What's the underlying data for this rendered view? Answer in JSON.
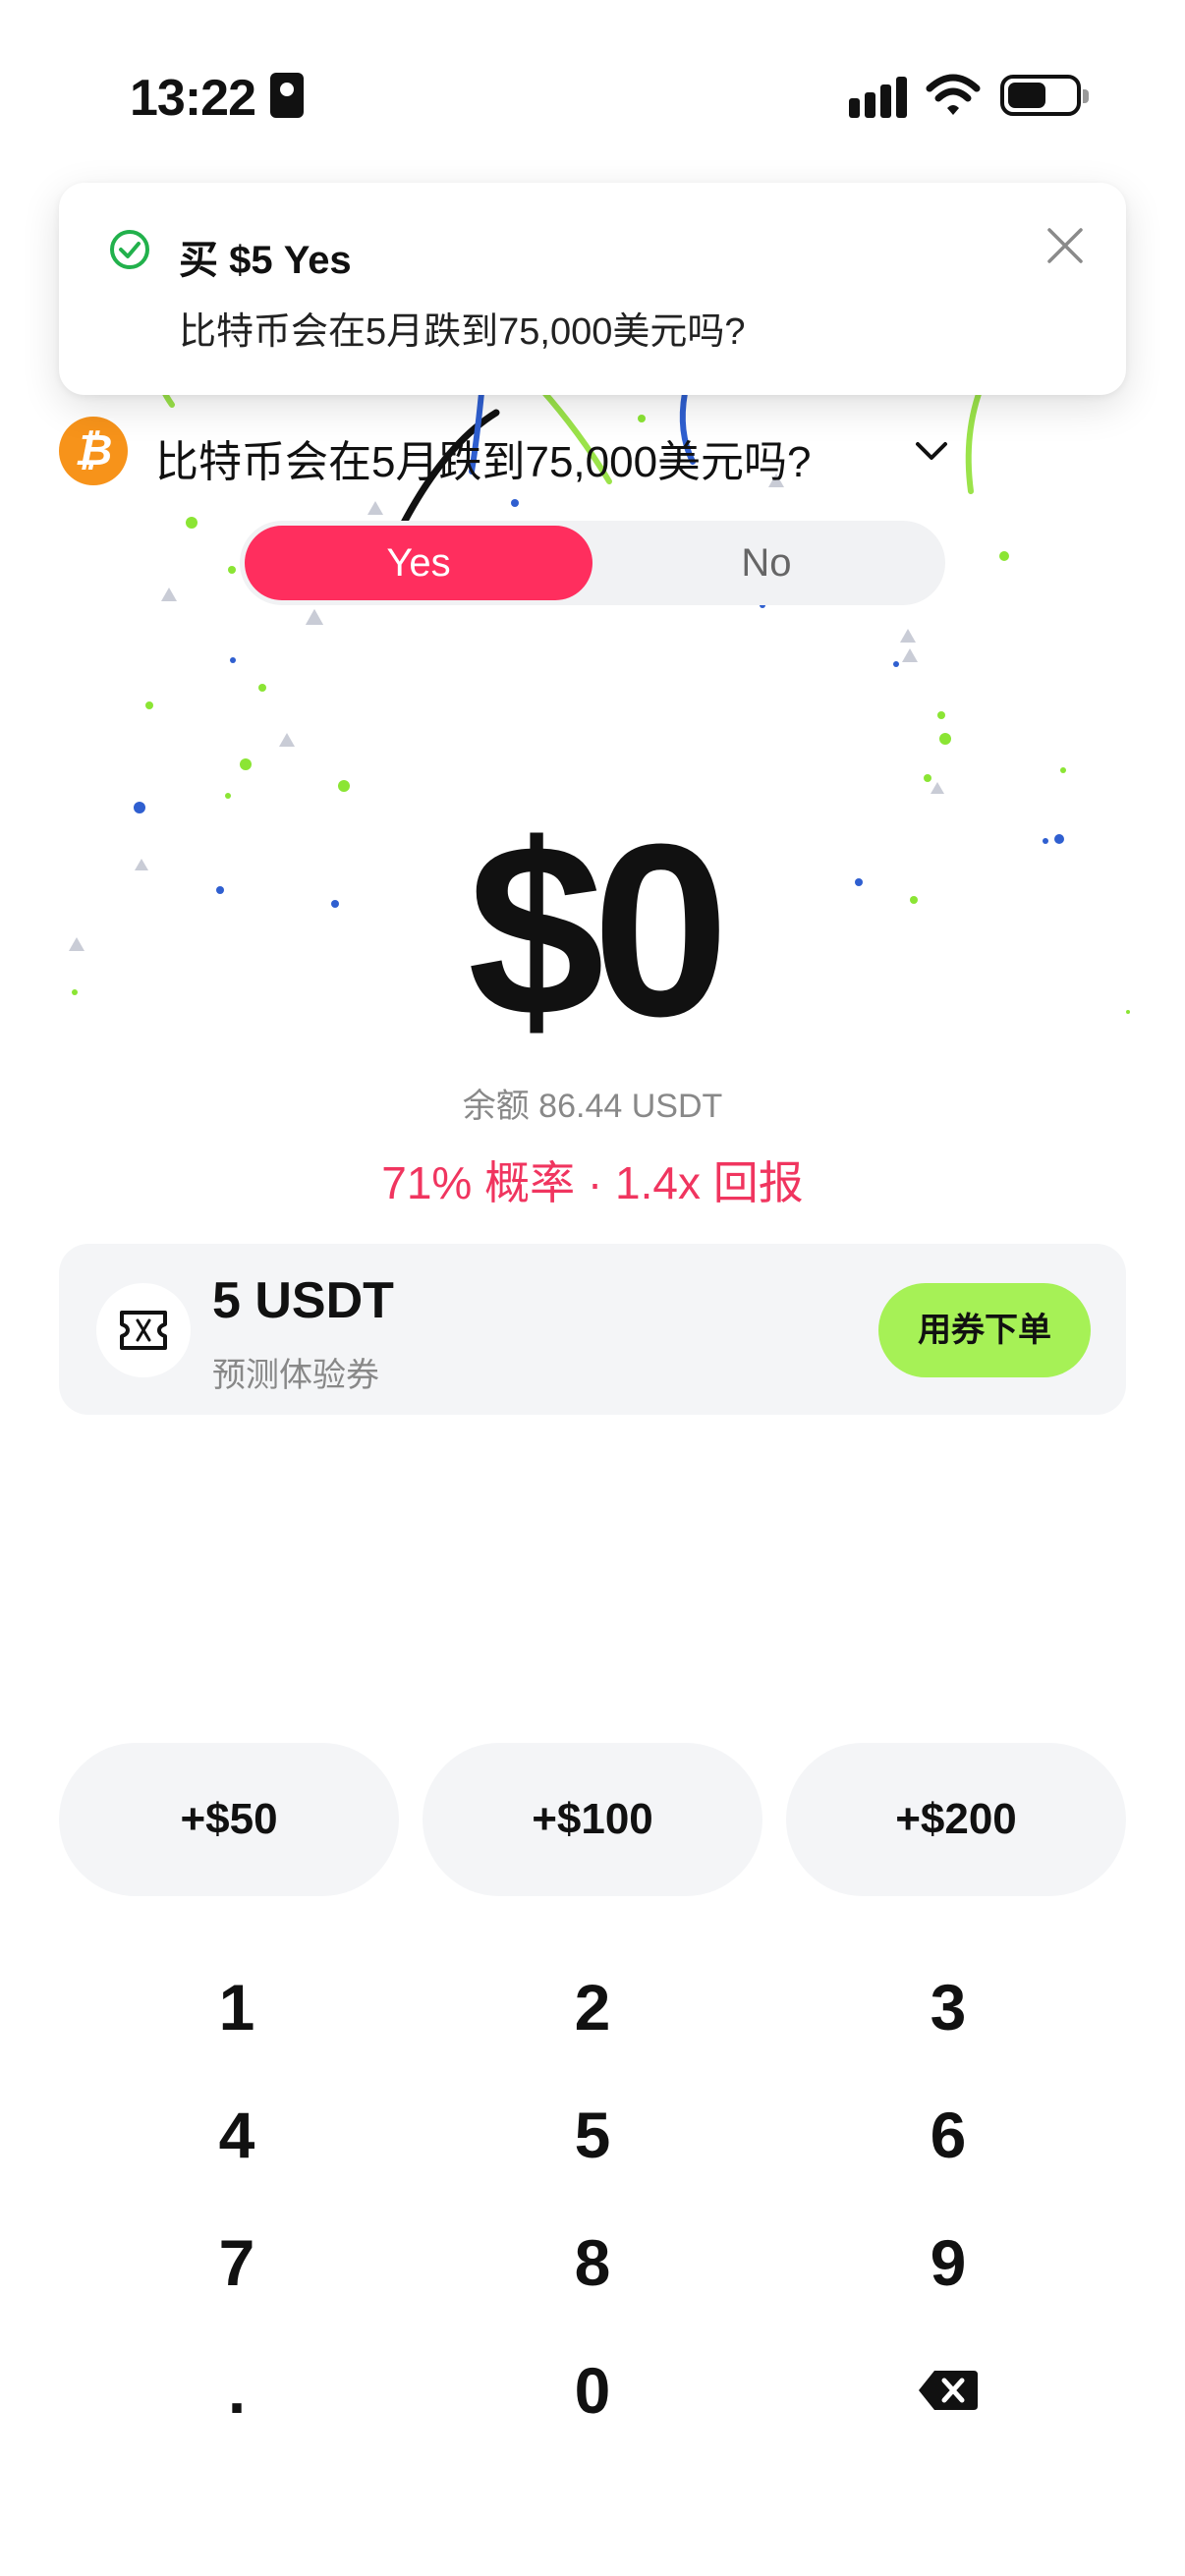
{
  "status_bar": {
    "time": "13:22"
  },
  "toast": {
    "title": "买 $5 Yes",
    "message": "比特币会在5月跌到75,000美元吗?",
    "icon": "check-circle-icon",
    "close_icon": "close-icon"
  },
  "market": {
    "icon": "bitcoin-icon",
    "icon_glyph": "₿",
    "title": "比特币会在5月跌到75,000美元吗?"
  },
  "toggle": {
    "yes": "Yes",
    "no": "No",
    "selected": "Yes"
  },
  "amount": {
    "value": "$0",
    "balance": "余额 86.44 USDT",
    "odds": "71% 概率 · 1.4x 回报"
  },
  "voucher": {
    "amount": "5 USDT",
    "label": "预测体验券",
    "button": "用券下单",
    "icon": "ticket-icon"
  },
  "quick_add": [
    "+$50",
    "+$100",
    "+$200"
  ],
  "keypad": {
    "keys": [
      "1",
      "2",
      "3",
      "4",
      "5",
      "6",
      "7",
      "8",
      "9",
      ".",
      "0",
      "backspace"
    ]
  },
  "colors": {
    "accent_yes": "#FF2E5E",
    "odds_text": "#F0355F",
    "voucher_button": "#A6F156",
    "bitcoin": "#F7931A",
    "success": "#22B14C"
  }
}
